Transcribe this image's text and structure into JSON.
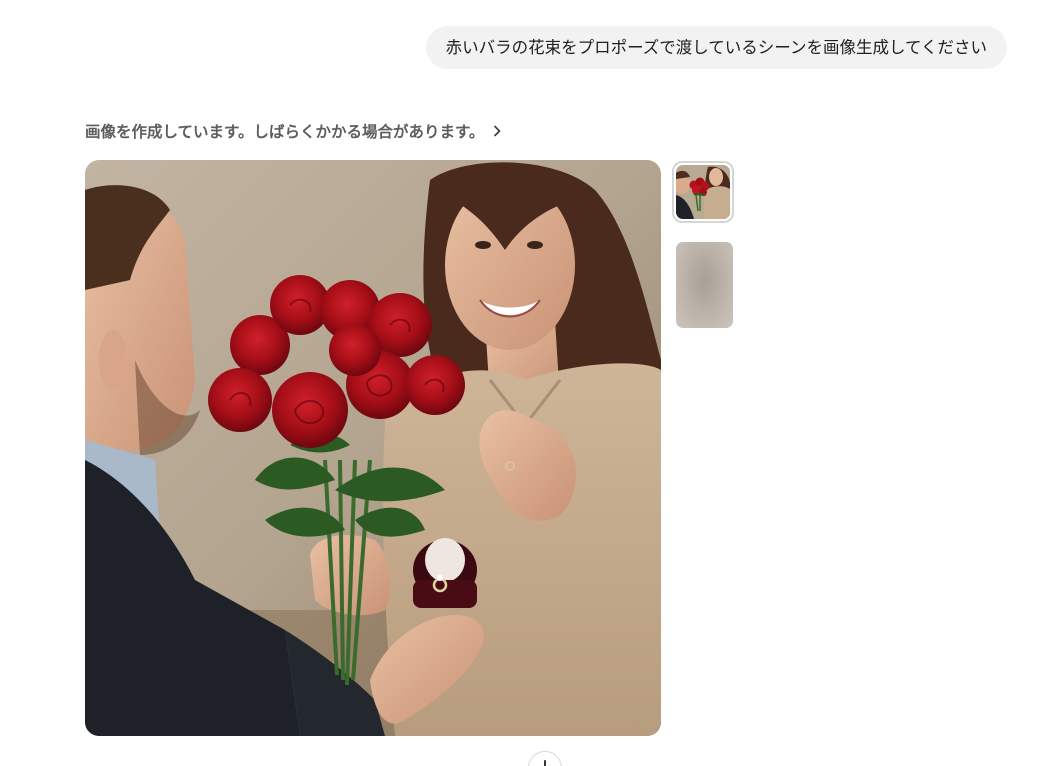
{
  "conversation": {
    "user_message": "赤いバラの花束をプロポーズで渡しているシーンを画像生成してください",
    "status_text": "画像を作成しています。しばらくかかる場合があります。",
    "status_icon": "chevron-right-icon"
  },
  "main_image": {
    "subject": "proposal-scene-with-red-roses",
    "palette": {
      "background": "#b9aa97",
      "rose_red": "#b0111a",
      "sweater": "#c8ae90",
      "jacket": "#1e2228"
    }
  },
  "thumbnails": [
    {
      "state": "selected"
    },
    {
      "state": "loading"
    }
  ],
  "scroll_button": {
    "icon": "arrow-down-icon"
  }
}
